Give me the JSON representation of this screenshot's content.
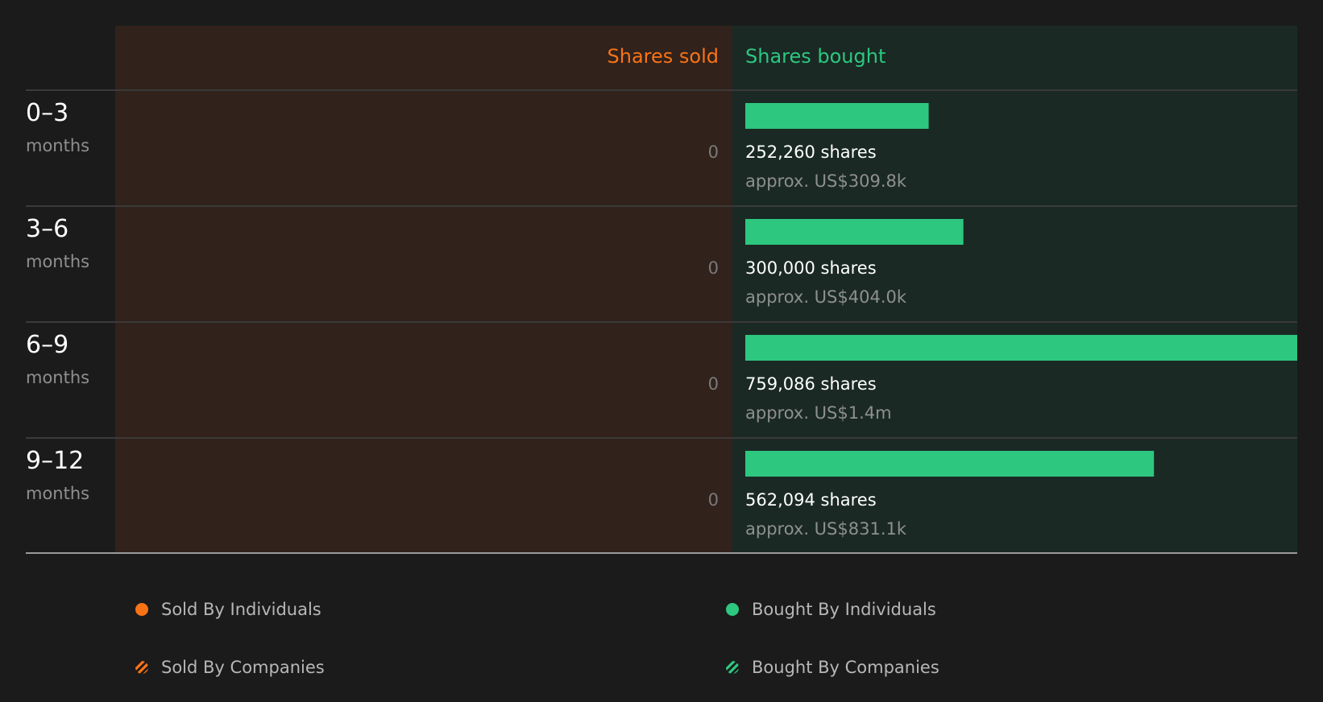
{
  "chart_data": {
    "type": "bar",
    "orientation": "horizontal-diverging",
    "categories": [
      {
        "range": "0–3",
        "unit": "months"
      },
      {
        "range": "3–6",
        "unit": "months"
      },
      {
        "range": "6–9",
        "unit": "months"
      },
      {
        "range": "9–12",
        "unit": "months"
      }
    ],
    "sold": {
      "header": "Shares sold",
      "values": [
        0,
        0,
        0,
        0
      ],
      "labels": [
        "0",
        "0",
        "0",
        "0"
      ]
    },
    "bought": {
      "header": "Shares bought",
      "values": [
        252260,
        300000,
        759086,
        562094
      ],
      "share_labels": [
        "252,260 shares",
        "300,000 shares",
        "759,086 shares",
        "562,094 shares"
      ],
      "value_labels": [
        "approx. US$309.8k",
        "approx. US$404.0k",
        "approx. US$1.4m",
        "approx. US$831.1k"
      ]
    },
    "legend": [
      {
        "label": "Sold By Individuals",
        "color": "#f97316",
        "pattern": "solid"
      },
      {
        "label": "Bought By Individuals",
        "color": "#2dc77f",
        "pattern": "solid"
      },
      {
        "label": "Sold By Companies",
        "color": "#f97316",
        "pattern": "hatched"
      },
      {
        "label": "Bought By Companies",
        "color": "#2dc77f",
        "pattern": "hatched"
      }
    ]
  },
  "colors": {
    "background": "#1b1b1b",
    "sold_panel": "#31221b",
    "bought_panel": "#1a2924",
    "sold_accent": "#f97316",
    "bought_accent": "#2dc77f",
    "primary_text": "#ffffff",
    "muted_text": "#8f8f8f",
    "zero_text": "#7a7a7a",
    "divider": "#3a3a3a",
    "baseline": "#9a9a9a"
  }
}
